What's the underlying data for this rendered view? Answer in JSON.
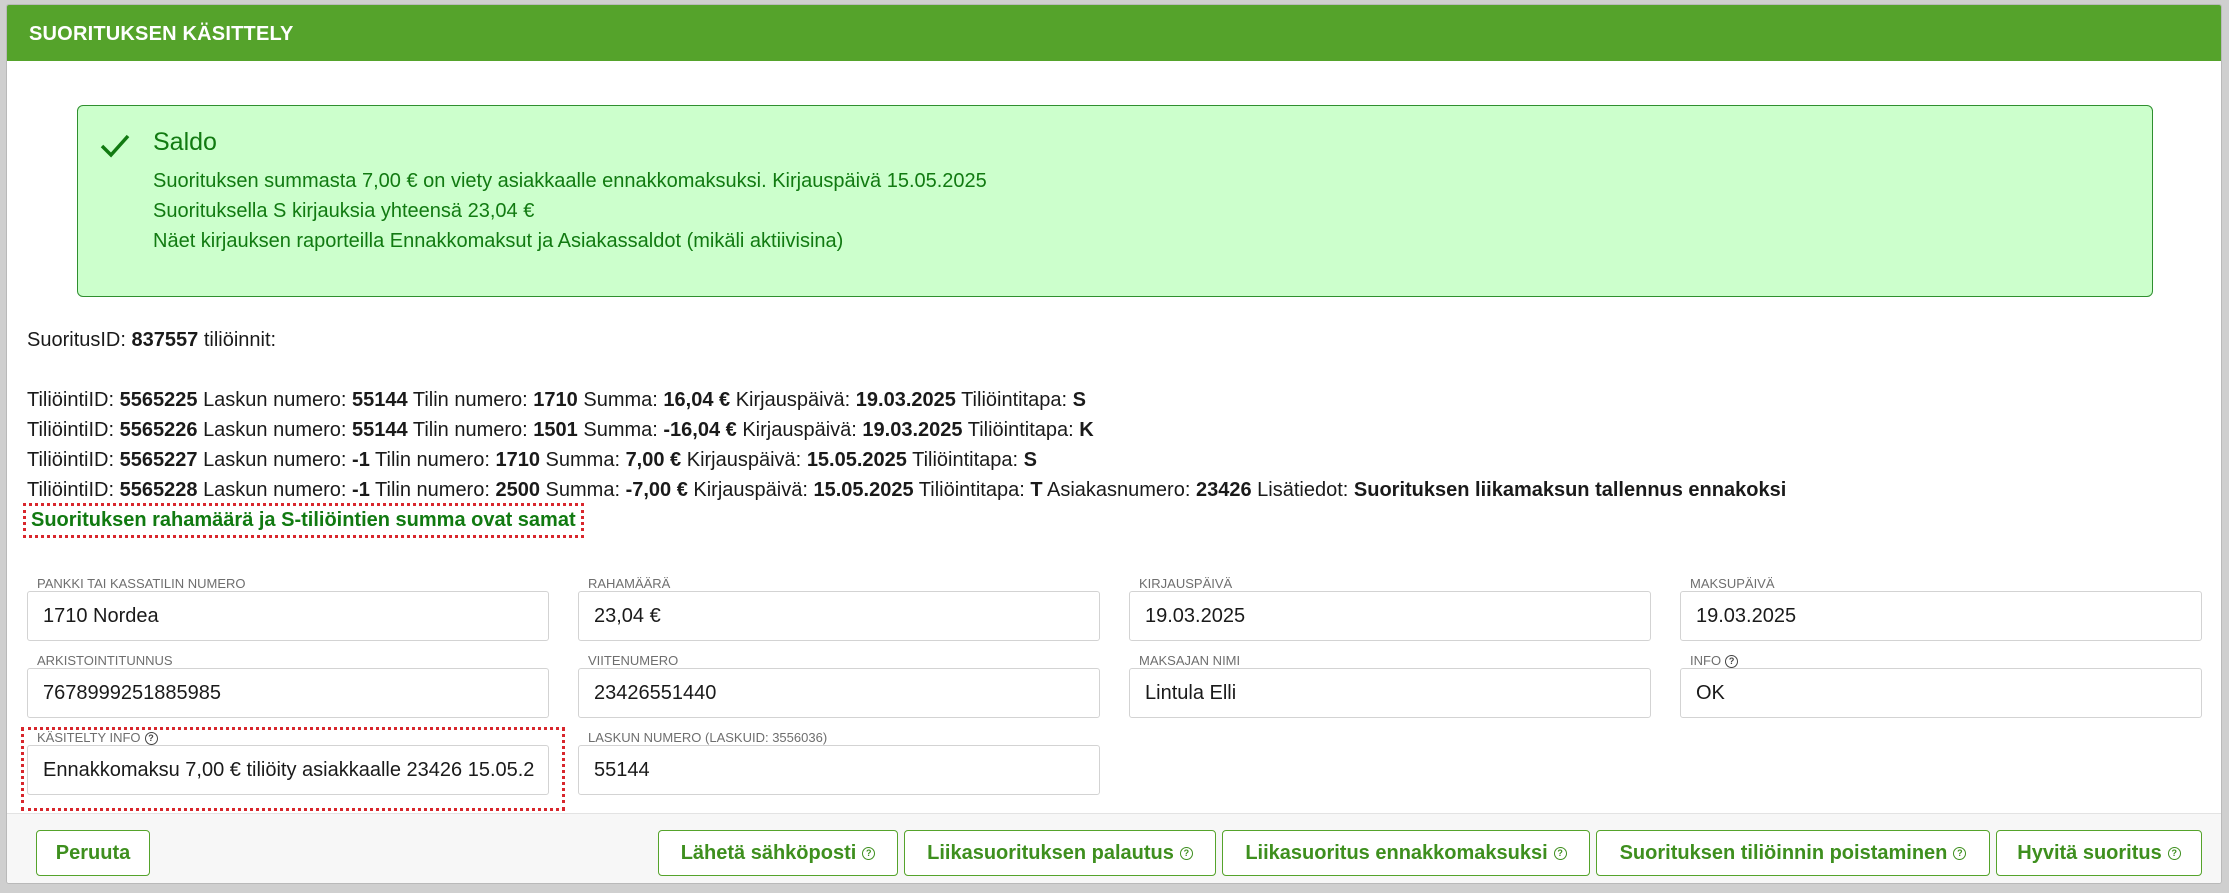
{
  "header": {
    "title": "SUORITUKSEN KÄSITTELY"
  },
  "alert": {
    "heading": "Saldo",
    "lines": [
      "Suorituksen summasta 7,00 € on viety asiakkaalle ennakkomaksuksi. Kirjauspäivä 15.05.2025",
      "Suorituksella S kirjauksia yhteensä 23,04 €",
      "Näet kirjauksen raporteilla Ennakkomaksut ja Asiakassaldot (mikäli aktiivisina)"
    ]
  },
  "suoritus": {
    "label": "SuoritusID:",
    "id": "837557",
    "suffix": "tiliöinnit:"
  },
  "postings": [
    {
      "id": "5565225",
      "invoice": "55144",
      "account": "1710",
      "amount": "16,04 €",
      "date": "19.03.2025",
      "method": "S"
    },
    {
      "id": "5565226",
      "invoice": "55144",
      "account": "1501",
      "amount": "-16,04 €",
      "date": "19.03.2025",
      "method": "K"
    },
    {
      "id": "5565227",
      "invoice": "-1",
      "account": "1710",
      "amount": "7,00 €",
      "date": "15.05.2025",
      "method": "S"
    },
    {
      "id": "5565228",
      "invoice": "-1",
      "account": "2500",
      "amount": "-7,00 €",
      "date": "15.05.2025",
      "method": "T",
      "customer": "23426",
      "extra": "Suorituksen liikamaksun tallennus ennakoksi"
    }
  ],
  "labels": {
    "posting_id": "TiliöintiID:",
    "invoice_no": "Laskun numero:",
    "account_no": "Tilin numero:",
    "amount": "Summa:",
    "booking_date": "Kirjauspäivä:",
    "method": "Tiliöintitapa:",
    "customer_no": "Asiakasnumero:",
    "extra_info": "Lisätiedot:"
  },
  "sum_check": "Suorituksen rahamäärä ja S-tiliöintien summa ovat samat",
  "fields": {
    "bank": {
      "label": "PANKKI TAI KASSATILIN NUMERO",
      "value": "1710 Nordea"
    },
    "amount": {
      "label": "RAHAMÄÄRÄ",
      "value": "23,04 €"
    },
    "booking_date": {
      "label": "KIRJAUSPÄIVÄ",
      "value": "19.03.2025"
    },
    "payment_date": {
      "label": "MAKSUPÄIVÄ",
      "value": "19.03.2025"
    },
    "archive_id": {
      "label": "ARKISTOINTITUNNUS",
      "value": "7678999251885985"
    },
    "reference": {
      "label": "VIITENUMERO",
      "value": "23426551440"
    },
    "payer_name": {
      "label": "MAKSAJAN NIMI",
      "value": "Lintula Elli"
    },
    "info": {
      "label": "INFO",
      "value": "OK"
    },
    "handled_info": {
      "label": "KÄSITELTY INFO",
      "value": "Ennakkomaksu 7,00 € tiliöity asiakkaalle 23426 15.05.2"
    },
    "invoice_number": {
      "label": "LASKUN NUMERO (LASKUID: 3556036)",
      "value": "55144"
    }
  },
  "buttons": {
    "cancel": "Peruuta",
    "send_email": "Lähetä sähköposti",
    "refund_overpayment": "Liikasuorituksen palautus",
    "overpayment_prepayment": "Liikasuoritus ennakkomaksuksi",
    "remove_posting": "Suorituksen tiliöinnin poistaminen",
    "credit_payment": "Hyvitä suoritus"
  },
  "help_glyph": "?",
  "colors": {
    "header": "#55a32b",
    "alert_bg": "#ccffcc",
    "alert_text": "#117a11",
    "highlight": "#d8262c"
  }
}
